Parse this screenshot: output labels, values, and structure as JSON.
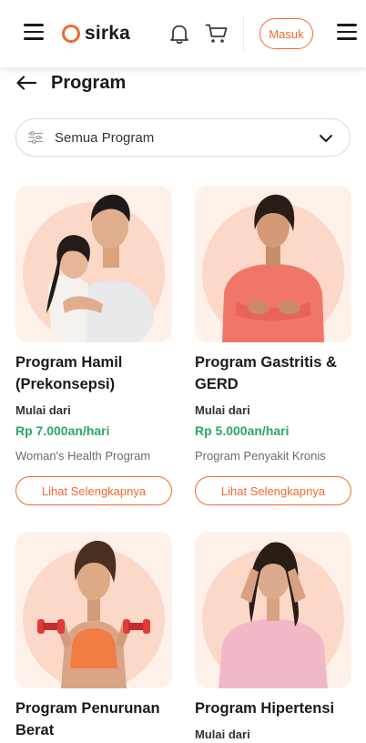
{
  "header": {
    "logo_text": "sirka",
    "login_label": "Masuk",
    "accent_color": "#f26a2e"
  },
  "page": {
    "title": "Program"
  },
  "filter": {
    "selected": "Semua Program"
  },
  "programs": [
    {
      "title": "Program Hamil (Prekonsepsi)",
      "from_label": "Mulai dari",
      "price": "Rp 7.000an/hari",
      "category": "Woman's Health Program",
      "button_label": "Lihat Selengkapnya",
      "image": "couple-photo"
    },
    {
      "title": "Program Gastritis & GERD",
      "from_label": "Mulai dari",
      "price": "Rp 5.000an/hari",
      "category": "Program Penyakit Kronis",
      "button_label": "Lihat Selengkapnya",
      "image": "stomach-ache-photo"
    },
    {
      "title": "Program Penurunan Berat",
      "image": "dumbbell-woman-photo"
    },
    {
      "title": "Program Hipertensi",
      "from_label": "Mulai dari",
      "image": "headache-woman-photo"
    }
  ]
}
